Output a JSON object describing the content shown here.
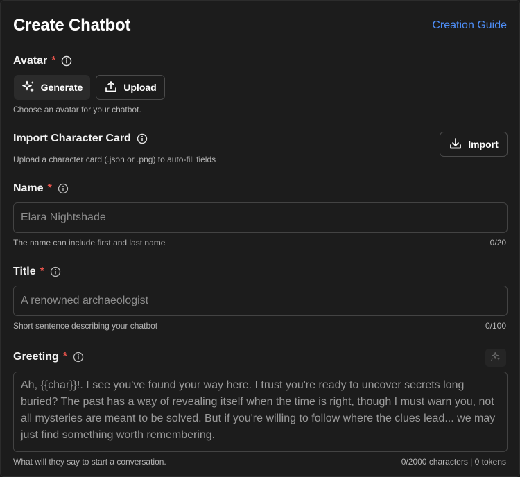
{
  "header": {
    "title": "Create Chatbot",
    "guide_link": "Creation Guide"
  },
  "avatar": {
    "label": "Avatar",
    "required_mark": "*",
    "generate_label": "Generate",
    "upload_label": "Upload",
    "help": "Choose an avatar for your chatbot."
  },
  "import_card": {
    "label": "Import Character Card",
    "help": "Upload a character card (.json or .png) to auto-fill fields",
    "import_label": "Import"
  },
  "name": {
    "label": "Name",
    "required_mark": "*",
    "placeholder": "Elara Nightshade",
    "help": "The name can include first and last name",
    "counter": "0/20"
  },
  "title_field": {
    "label": "Title",
    "required_mark": "*",
    "placeholder": "A renowned archaeologist",
    "help": "Short sentence describing your chatbot",
    "counter": "0/100"
  },
  "greeting": {
    "label": "Greeting",
    "required_mark": "*",
    "placeholder": "Ah, {{char}}!. I see you've found your way here. I trust you're ready to uncover secrets long buried? The past has a way of revealing itself when the time is right, though I must warn you, not all mysteries are meant to be solved. But if you're willing to follow where the clues lead... we may just find something worth remembering.",
    "help": "What will they say to start a conversation.",
    "counter": "0/2000 characters | 0 tokens"
  },
  "colors": {
    "background": "#1c1c1c",
    "link": "#4e8ef7",
    "required": "#e5534b",
    "border": "#434343"
  },
  "icons": [
    "info-icon",
    "sparkles-icon",
    "upload-icon",
    "download-icon"
  ]
}
